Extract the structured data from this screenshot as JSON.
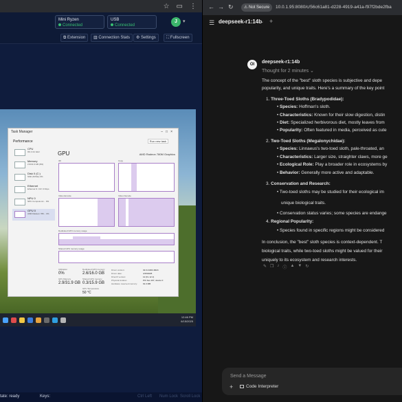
{
  "left_browser": {
    "chrome_icons": [
      "star-icon",
      "sidebar-icon",
      "more-icon"
    ],
    "connections": [
      {
        "name": "Mini Ryzen",
        "status": "Connected",
        "icon": "monitor-icon"
      },
      {
        "name": "USB",
        "status": "Connected",
        "icon": "usb-icon"
      }
    ],
    "avatar_letter": "J",
    "toolbar": {
      "extension": "Extension",
      "connection_stats": "Connection Stats",
      "settings": "Settings",
      "fullscreen": "Fullscreen"
    },
    "status_bar": {
      "state": "State: ready",
      "keys": "Keys:",
      "ghost_1": "Ctrl Left",
      "ghost_2": "Num Lock",
      "ghost_3": "Scroll Lock"
    }
  },
  "task_manager": {
    "title": "Task Manager",
    "section": "Performance",
    "run_new_task": "Run new task",
    "items": [
      {
        "name": "CPU",
        "detail": "9% 3.31 GHz"
      },
      {
        "name": "Memory",
        "detail": "2.9/31.9 GB (9%)"
      },
      {
        "name": "Disk 0 (C:)",
        "detail": "SSD (NVMe) 0%"
      },
      {
        "name": "Ethernet",
        "detail": "Ethernet S: 0 R: 0 Kbps"
      },
      {
        "name": "NPU 0",
        "detail": "NPU Compute Ac... 0%"
      },
      {
        "name": "GPU 0",
        "detail": "AMD Radeon 780... 0%"
      }
    ],
    "gpu_title": "GPU",
    "gpu_name": "AMD Radeon 780M Graphics",
    "graph_labels": [
      "3D",
      "Copy",
      "Video Encode",
      "Video Decode",
      "Dedicated GPU memory usage",
      "Shared GPU memory usage"
    ],
    "stats": [
      {
        "label": "Utilization",
        "value": "0%"
      },
      {
        "label": "Dedicated GPU memory",
        "value": "2.6/16.0 GB"
      },
      {
        "label": "GPU Memory",
        "value": "2.9/31.9 GB"
      },
      {
        "label": "Shared GPU memory",
        "value": "0.3/15.9 GB"
      },
      {
        "label": "GPU Temperature",
        "value": "50 °C"
      }
    ],
    "details": [
      {
        "k": "Driver version:",
        "v": "32.0.21001.9024"
      },
      {
        "k": "Driver date:",
        "v": "4/15/2025"
      },
      {
        "k": "DirectX version:",
        "v": "12 (FL 12.1)"
      },
      {
        "k": "Physical location:",
        "v": "PCI bus 197, device 0"
      },
      {
        "k": "Hardware reserved memory:",
        "v": "91.3 MB"
      }
    ],
    "taskbar_time": "12:46 PM",
    "taskbar_date": "6/15/2025"
  },
  "right_browser": {
    "not_secure": "Not Secure",
    "url": "10.0.1.95:8080/c/56c61a81-d228-4919-a41a-f97f2bde2fba",
    "model_title": "deepseek-r1:14b",
    "response": {
      "model_name": "deepseek-r1:14b",
      "thought": "Thought for 2 minutes",
      "intro_1": "The concept of the \"best\" sloth species is subjective and depe",
      "intro_2": "popularity, and unique traits. Here's a summary of the key point",
      "n1": "1.",
      "h1": "Three-Toed Sloths (Bradypodidae):",
      "h1_species_label": "Species:",
      "h1_species": "Hoffman's sloth.",
      "h1_char_label": "Characteristics:",
      "h1_char": "Known for their slow digestion, distin",
      "h1_diet_label": "Diet:",
      "h1_diet": "Specialized herbivorous diet, mostly leaves from",
      "h1_pop_label": "Popularity:",
      "h1_pop": "Often featured in media, perceived as cute",
      "n2": "2.",
      "h2": "Two-Toed Sloths (Megalonychidae):",
      "h2_species_label": "Species:",
      "h2_species": "Linnaeus's two-toed sloth, pale-throated, an",
      "h2_char_label": "Characteristics:",
      "h2_char": "Larger size, straighter claws, more ge",
      "h2_eco_label": "Ecological Role:",
      "h2_eco": "Play a broader role in ecosystems by",
      "h2_beh_label": "Behavior:",
      "h2_beh": "Generally more active and adaptable.",
      "n3": "3.",
      "h3": "Conservation and Research:",
      "h3_1a": "Two-toed sloths may be studied for their ecological im",
      "h3_1b": "unique biological traits.",
      "h3_2": "Conservation status varies; some species are endange",
      "n4": "4.",
      "h4": "Regional Popularity:",
      "h4_1": "Species found in specific regions might be considered",
      "outro_1": "In conclusion, the \"best\" sloth species is context-dependent. T",
      "outro_2": "biological traits, while two-toed sloths might be valued for their",
      "outro_3": "uniquely to its ecosystem and research interests."
    },
    "actions": [
      "edit-icon",
      "copy-icon",
      "speaker-icon",
      "info-icon",
      "thumbs-up-icon",
      "thumbs-down-icon",
      "regenerate-icon"
    ],
    "composer": {
      "placeholder": "Send a Message",
      "code_interpreter": "Code Interpreter"
    }
  }
}
